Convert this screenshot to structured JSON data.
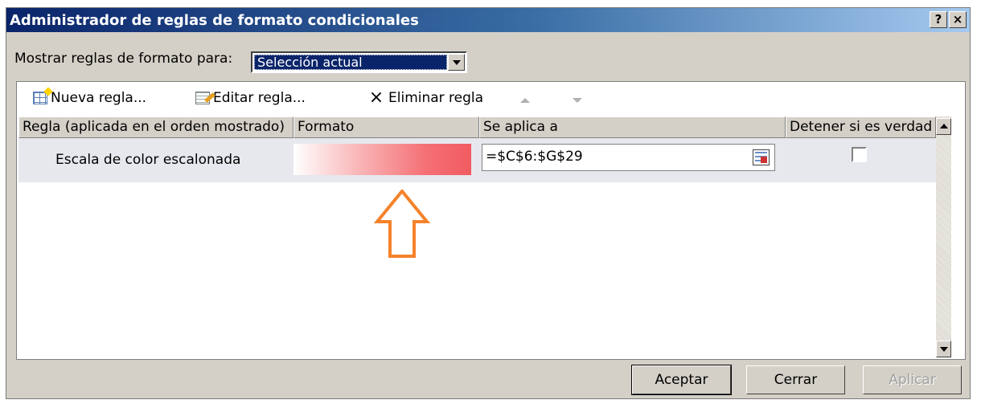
{
  "window": {
    "title": "Administrador de reglas de formato condicionales",
    "help_label": "?",
    "close_label": "×"
  },
  "show_rules": {
    "label": "Mostrar reglas de formato para:",
    "selected": "Selección actual"
  },
  "toolbar": {
    "new_rule": "Nueva regla...",
    "edit_rule": "Editar regla...",
    "delete_rule": "Eliminar regla",
    "delete_icon": "×"
  },
  "table": {
    "headers": [
      "Regla (aplicada en el orden mostrado)",
      "Formato",
      "Se aplica a",
      "Detener si es verdad"
    ],
    "rows": [
      {
        "rule": "Escala de color escalonada",
        "applies_to": "=$C$6:$G$29",
        "stop_if_true": false
      }
    ]
  },
  "buttons": {
    "ok": "Aceptar",
    "close": "Cerrar",
    "apply": "Aplicar"
  },
  "colors": {
    "title_bar": "#0a246a",
    "annotation_arrow": "#f5822a",
    "format_preview_end": "#f25b62"
  },
  "icons": {
    "new_rule": "new-rule-icon",
    "edit_rule": "edit-rule-icon",
    "delete_rule": "delete-x-icon",
    "move_up": "move-up-icon",
    "move_down": "move-down-icon",
    "range_picker": "range-picker-icon",
    "annotation": "up-arrow-outline-icon"
  }
}
